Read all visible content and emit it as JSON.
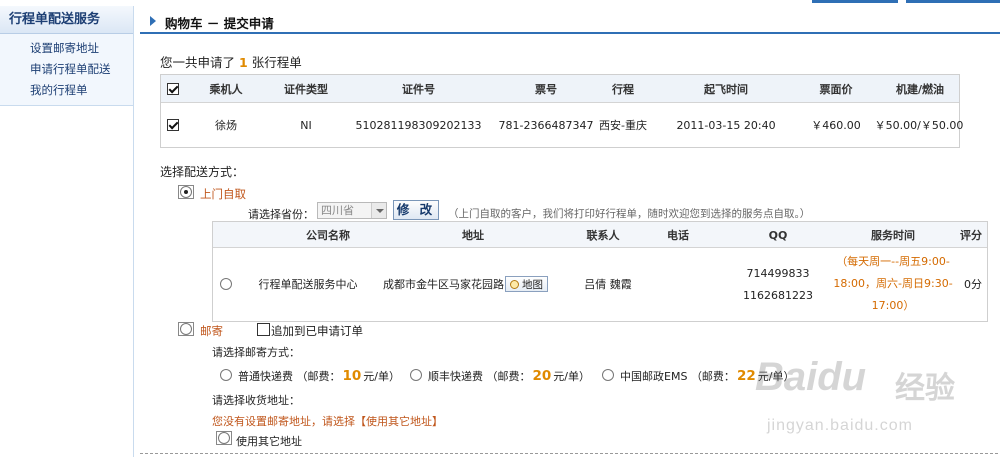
{
  "sidebar": {
    "title": "行程单配送服务",
    "items": [
      {
        "label": "设置邮寄地址"
      },
      {
        "label": "申请行程单配送"
      },
      {
        "label": "我的行程单"
      }
    ]
  },
  "header": {
    "title": "购物车 － 提交申请"
  },
  "summary": {
    "prefix": "您一共申请了",
    "count": "1",
    "suffix": "张行程单"
  },
  "tickets": {
    "columns": [
      "乘机人",
      "证件类型",
      "证件号",
      "票号",
      "行程",
      "起飞时间",
      "票面价",
      "机建/燃油"
    ],
    "rows": [
      {
        "checked": true,
        "passenger": "徐炀",
        "id_type": "NI",
        "id_number": "510281198309202133",
        "ticket_number": "781-2366487347",
        "route": "西安-重庆",
        "departure": "2011-03-15 20:40",
        "fare": "￥460.00",
        "tax": "￥50.00/￥50.00"
      }
    ]
  },
  "delivery": {
    "section_title": "选择配送方式：",
    "pickup": {
      "label": "上门自取",
      "selected": true,
      "province_label": "请选择省份：",
      "province_value": "四川省",
      "modify_button": "修 改",
      "hint": "（上门自取的客户，我们将打印好行程单，随时欢迎您到选择的服务点自取。）",
      "table": {
        "columns": [
          "公司名称",
          "地址",
          "联系人",
          "电话",
          "QQ",
          "服务时间",
          "评分"
        ],
        "rows": [
          {
            "company": "行程单配送服务中心",
            "address": "成都市金牛区马家花园路",
            "map_button": "地图",
            "contact": "吕倩 魏霞",
            "phone": "",
            "qq1": "714499833",
            "qq2": "1162681223",
            "service_time": [
              "（每天周一--周五9:00-",
              "18:00，周六-周日9:30-",
              "17:00）"
            ],
            "rating": "0分"
          }
        ]
      }
    },
    "mail": {
      "label": "邮寄",
      "append_label": "追加到已申请订单",
      "method_title": "请选择邮寄方式：",
      "methods": [
        {
          "name": "普通快递费",
          "fee_prefix": "（邮费：",
          "fee": "10",
          "fee_suffix": "元/单）"
        },
        {
          "name": "顺丰快递费",
          "fee_prefix": "（邮费：",
          "fee": "20",
          "fee_suffix": "元/单）"
        },
        {
          "name": "中国邮政EMS",
          "fee_prefix": "（邮费：",
          "fee": "22",
          "fee_suffix": "元/单）"
        }
      ],
      "address_title": "请选择收货地址：",
      "no_address_warning": "您没有设置邮寄地址，请选择【使用其它地址】",
      "use_other_label": "使用其它地址"
    }
  },
  "watermark": {
    "logo": "Baidu",
    "cn": "经验",
    "url": "jingyan.baidu.com"
  },
  "colors": {
    "accent": "#2f6fb5",
    "orange": "#e08a00",
    "option": "#c0561b"
  }
}
